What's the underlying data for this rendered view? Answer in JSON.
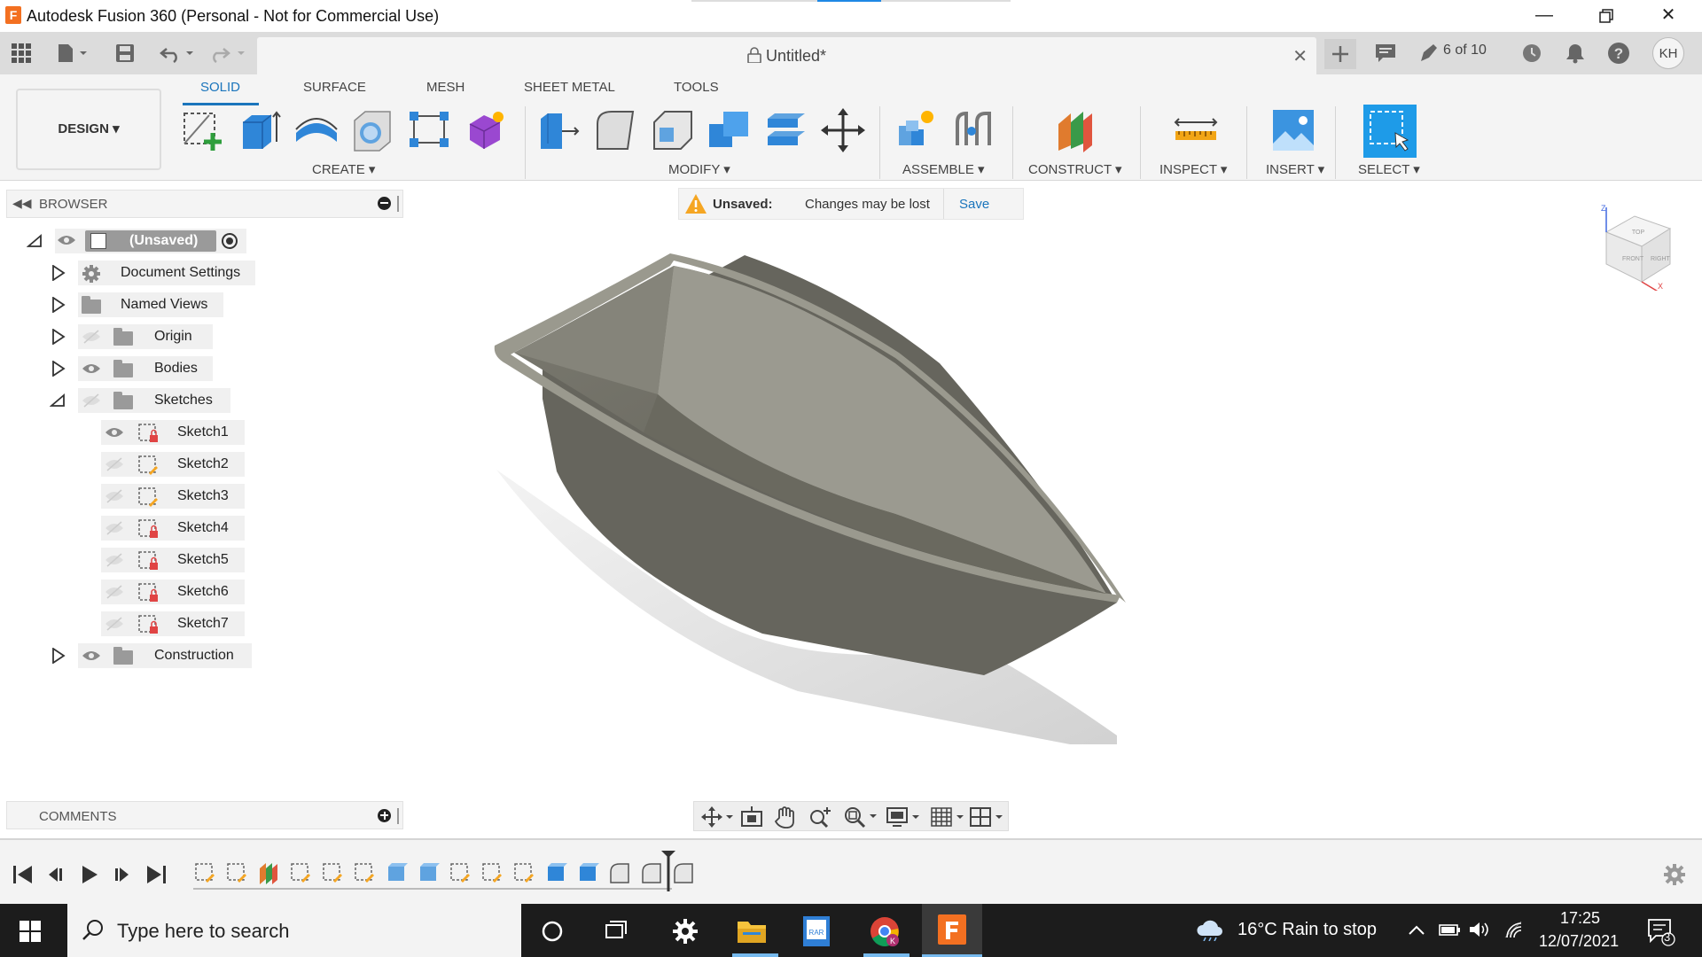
{
  "window": {
    "title": "Autodesk Fusion 360 (Personal - Not for Commercial Use)",
    "app_logo_letter": "F",
    "controls": [
      "minimize",
      "restore",
      "close"
    ]
  },
  "tabbar": {
    "doc_title": "Untitled*",
    "doc_count": "6 of 10",
    "user_initials": "KH"
  },
  "ribbon": {
    "tabs": [
      "SOLID",
      "SURFACE",
      "MESH",
      "SHEET METAL",
      "TOOLS"
    ],
    "active_tab": "SOLID",
    "workspace": "DESIGN",
    "groups": [
      "CREATE",
      "MODIFY",
      "ASSEMBLE",
      "CONSTRUCT",
      "INSPECT",
      "INSERT",
      "SELECT"
    ]
  },
  "browser": {
    "header": "BROWSER",
    "root": "(Unsaved)",
    "items": [
      {
        "label": "Document Settings",
        "icon": "gear-icon"
      },
      {
        "label": "Named Views",
        "icon": "folder-icon"
      },
      {
        "label": "Origin",
        "icon": "folder-icon"
      },
      {
        "label": "Bodies",
        "icon": "folder-icon"
      },
      {
        "label": "Sketches",
        "icon": "folder-icon"
      },
      {
        "label": "Construction",
        "icon": "folder-icon"
      }
    ],
    "sketches": [
      "Sketch1",
      "Sketch2",
      "Sketch3",
      "Sketch4",
      "Sketch5",
      "Sketch6",
      "Sketch7"
    ]
  },
  "notice": {
    "status": "Unsaved:",
    "message": "Changes may be lost",
    "action": "Save"
  },
  "viewcube": {
    "faces": [
      "TOP",
      "FRONT",
      "RIGHT"
    ],
    "axes": [
      "Z",
      "X"
    ]
  },
  "comments": {
    "header": "COMMENTS"
  },
  "taskbar": {
    "search_placeholder": "Type here to search",
    "weather": "16°C  Rain to stop",
    "time": "17:25",
    "date": "12/07/2021",
    "notifications": "3"
  },
  "colors": {
    "accent": "#1b75bc",
    "model": "#6b6a62",
    "warning": "#f5a623"
  }
}
